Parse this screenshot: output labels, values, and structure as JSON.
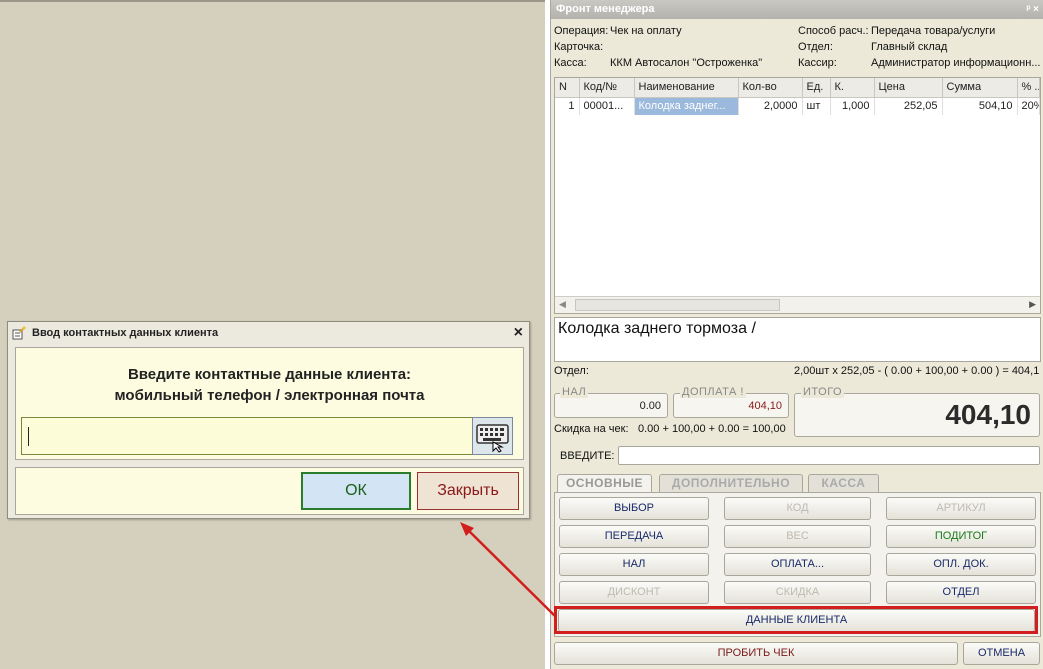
{
  "front": {
    "title": "Фронт менеджера",
    "title_controls": "ᵖ ×",
    "operation_label": "Операция:",
    "operation_value": "Чек на оплату",
    "card_label": "Карточка:",
    "kassa_label": "Касса:",
    "kassa_value": "ККМ Автосалон \"Остроженка\"",
    "pay_label": "Способ расч.:",
    "pay_value": "Передача товара/услуги",
    "dept_label": "Отдел:",
    "dept_value": "Главный склад",
    "cashier_label": "Кассир:",
    "cashier_value": "Администратор информационн..."
  },
  "grid": {
    "columns": [
      "N",
      "Код/№",
      "Наименование",
      "Кол-во",
      "Ед.",
      "К.",
      "Цена",
      "Сумма",
      "% ..."
    ],
    "rows": [
      [
        "1",
        "00001...",
        "Колодка заднег...",
        "2,0000",
        "шт",
        "1,000",
        "252,05",
        "504,10",
        "20%"
      ]
    ]
  },
  "item_name": "Колодка заднего тормоза /",
  "calc": {
    "dept_label": "Отдел:",
    "formula": "2,00шт х 252,05 - ( 0.00 + 100,00 + 0.00 ) = 404,1..."
  },
  "totals": {
    "nal_label": "НАЛ",
    "nal_value": "0.00",
    "doplata_label": "ДОПЛАТА !",
    "doplata_value": "404,10",
    "itogo_label": "ИТОГО",
    "itogo_value": "404,10",
    "discount_label": "Скидка на чек:",
    "discount_value": "0.00 + 100,00 + 0.00 = 100,00",
    "enter_label": "ВВЕДИТЕ:"
  },
  "tabs": [
    "ОСНОВНЫЕ",
    "ДОПОЛНИТЕЛЬНО",
    "КАССА"
  ],
  "buttons": {
    "vybor": "ВЫБОР",
    "kod": "КОД",
    "artikul": "АРТИКУЛ",
    "peredacha": "ПЕРЕДАЧА",
    "ves": "ВЕС",
    "poditog": "ПОДИТОГ",
    "nal": "НАЛ",
    "oplata": "ОПЛАТА...",
    "opl_dok": "ОПЛ. ДОК.",
    "diskont": "ДИСКОНТ",
    "skidka": "СКИДКА",
    "otdel": "ОТДЕЛ",
    "dannye_klienta": "ДАННЫЕ КЛИЕНТА",
    "probit_chek": "ПРОБИТЬ ЧЕК",
    "otmena": "ОТМЕНА"
  },
  "dialog": {
    "title": "Ввод контактных данных клиента",
    "prompt_line1": "Введите контактные данные клиента:",
    "prompt_line2": "мобильный телефон / электронная почта",
    "input_value": "",
    "ok_label": "ОК",
    "close_label": "Закрыть"
  },
  "colors": {
    "highlight": "#d31e1e",
    "accent_green": "#1b7a1b",
    "dialog_bg": "#fdfce0"
  }
}
